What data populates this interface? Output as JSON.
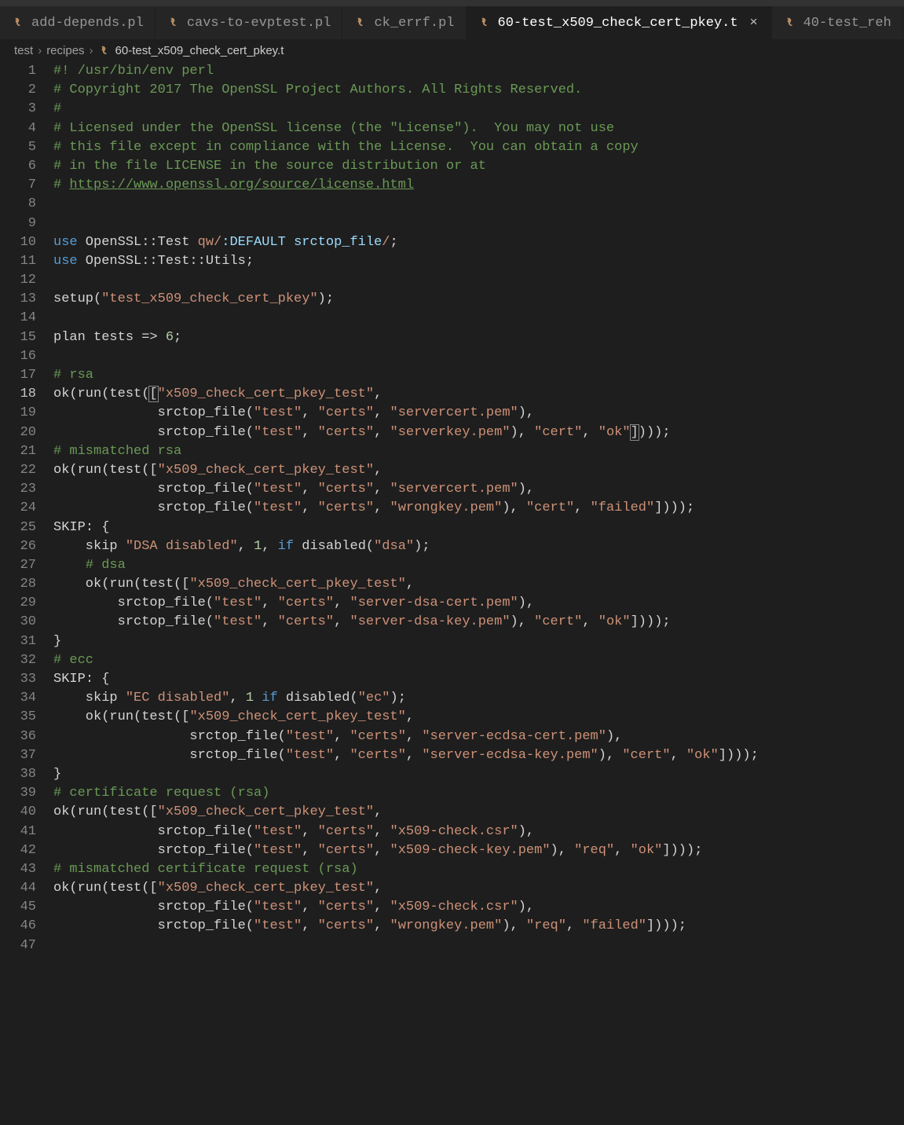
{
  "tabs": [
    {
      "label": "add-depends.pl",
      "active": false
    },
    {
      "label": "cavs-to-evptest.pl",
      "active": false
    },
    {
      "label": "ck_errf.pl",
      "active": false
    },
    {
      "label": "60-test_x509_check_cert_pkey.t",
      "active": true
    },
    {
      "label": "40-test_reh",
      "active": false
    }
  ],
  "breadcrumb": {
    "parts": [
      "test",
      "recipes"
    ],
    "file": "60-test_x509_check_cert_pkey.t"
  },
  "editor": {
    "current_line": 18,
    "lines": [
      {
        "n": 1,
        "tokens": [
          {
            "t": "#! /usr/bin/env perl",
            "c": "comment"
          }
        ]
      },
      {
        "n": 2,
        "tokens": [
          {
            "t": "# Copyright 2017 The OpenSSL Project Authors. All Rights Reserved.",
            "c": "comment"
          }
        ]
      },
      {
        "n": 3,
        "tokens": [
          {
            "t": "#",
            "c": "comment"
          }
        ]
      },
      {
        "n": 4,
        "tokens": [
          {
            "t": "# Licensed under the OpenSSL license (the \"License\").  You may not use",
            "c": "comment"
          }
        ]
      },
      {
        "n": 5,
        "tokens": [
          {
            "t": "# this file except in compliance with the License.  You can obtain a copy",
            "c": "comment"
          }
        ]
      },
      {
        "n": 6,
        "tokens": [
          {
            "t": "# in the file LICENSE in the source distribution or at",
            "c": "comment"
          }
        ]
      },
      {
        "n": 7,
        "tokens": [
          {
            "t": "# ",
            "c": "comment"
          },
          {
            "t": "https://www.openssl.org/source/license.html",
            "c": "link"
          }
        ]
      },
      {
        "n": 8,
        "tokens": []
      },
      {
        "n": 9,
        "tokens": []
      },
      {
        "n": 10,
        "tokens": [
          {
            "t": "use",
            "c": "key"
          },
          {
            "t": " OpenSSL::Test ",
            "c": "plain"
          },
          {
            "t": "qw/",
            "c": "str"
          },
          {
            "t": ":DEFAULT srctop_file",
            "c": "word"
          },
          {
            "t": "/",
            "c": "str"
          },
          {
            "t": ";",
            "c": "plain"
          }
        ]
      },
      {
        "n": 11,
        "tokens": [
          {
            "t": "use",
            "c": "key"
          },
          {
            "t": " OpenSSL::Test::Utils;",
            "c": "plain"
          }
        ]
      },
      {
        "n": 12,
        "tokens": []
      },
      {
        "n": 13,
        "tokens": [
          {
            "t": "setup(",
            "c": "plain"
          },
          {
            "t": "\"test_x509_check_cert_pkey\"",
            "c": "str"
          },
          {
            "t": ");",
            "c": "plain"
          }
        ]
      },
      {
        "n": 14,
        "tokens": []
      },
      {
        "n": 15,
        "tokens": [
          {
            "t": "plan ",
            "c": "plain"
          },
          {
            "t": "tests",
            "c": "plain"
          },
          {
            "t": " => ",
            "c": "plain"
          },
          {
            "t": "6",
            "c": "num"
          },
          {
            "t": ";",
            "c": "plain"
          }
        ]
      },
      {
        "n": 16,
        "tokens": []
      },
      {
        "n": 17,
        "tokens": [
          {
            "t": "# rsa",
            "c": "comment"
          }
        ]
      },
      {
        "n": 18,
        "tokens": [
          {
            "t": "ok(run(test(",
            "c": "plain"
          },
          {
            "t": "[",
            "c": "plain",
            "hl": true
          },
          {
            "t": "\"x509_check_cert_pkey_test\"",
            "c": "str"
          },
          {
            "t": ",",
            "c": "plain"
          }
        ]
      },
      {
        "n": 19,
        "tokens": [
          {
            "t": "             srctop_file(",
            "c": "plain"
          },
          {
            "t": "\"test\"",
            "c": "str"
          },
          {
            "t": ", ",
            "c": "plain"
          },
          {
            "t": "\"certs\"",
            "c": "str"
          },
          {
            "t": ", ",
            "c": "plain"
          },
          {
            "t": "\"servercert.pem\"",
            "c": "str"
          },
          {
            "t": "),",
            "c": "plain"
          }
        ]
      },
      {
        "n": 20,
        "tokens": [
          {
            "t": "             srctop_file(",
            "c": "plain"
          },
          {
            "t": "\"test\"",
            "c": "str"
          },
          {
            "t": ", ",
            "c": "plain"
          },
          {
            "t": "\"certs\"",
            "c": "str"
          },
          {
            "t": ", ",
            "c": "plain"
          },
          {
            "t": "\"serverkey.pem\"",
            "c": "str"
          },
          {
            "t": "), ",
            "c": "plain"
          },
          {
            "t": "\"cert\"",
            "c": "str"
          },
          {
            "t": ", ",
            "c": "plain"
          },
          {
            "t": "\"ok\"",
            "c": "str"
          },
          {
            "t": "]",
            "c": "plain",
            "hl": true
          },
          {
            "t": ")));",
            "c": "plain"
          }
        ]
      },
      {
        "n": 21,
        "tokens": [
          {
            "t": "# mismatched rsa",
            "c": "comment"
          }
        ]
      },
      {
        "n": 22,
        "tokens": [
          {
            "t": "ok(run(test([",
            "c": "plain"
          },
          {
            "t": "\"x509_check_cert_pkey_test\"",
            "c": "str"
          },
          {
            "t": ",",
            "c": "plain"
          }
        ]
      },
      {
        "n": 23,
        "tokens": [
          {
            "t": "             srctop_file(",
            "c": "plain"
          },
          {
            "t": "\"test\"",
            "c": "str"
          },
          {
            "t": ", ",
            "c": "plain"
          },
          {
            "t": "\"certs\"",
            "c": "str"
          },
          {
            "t": ", ",
            "c": "plain"
          },
          {
            "t": "\"servercert.pem\"",
            "c": "str"
          },
          {
            "t": "),",
            "c": "plain"
          }
        ]
      },
      {
        "n": 24,
        "tokens": [
          {
            "t": "             srctop_file(",
            "c": "plain"
          },
          {
            "t": "\"test\"",
            "c": "str"
          },
          {
            "t": ", ",
            "c": "plain"
          },
          {
            "t": "\"certs\"",
            "c": "str"
          },
          {
            "t": ", ",
            "c": "plain"
          },
          {
            "t": "\"wrongkey.pem\"",
            "c": "str"
          },
          {
            "t": "), ",
            "c": "plain"
          },
          {
            "t": "\"cert\"",
            "c": "str"
          },
          {
            "t": ", ",
            "c": "plain"
          },
          {
            "t": "\"failed\"",
            "c": "str"
          },
          {
            "t": "])));",
            "c": "plain"
          }
        ]
      },
      {
        "n": 25,
        "tokens": [
          {
            "t": "SKIP",
            "c": "plain"
          },
          {
            "t": ": {",
            "c": "plain"
          }
        ]
      },
      {
        "n": 26,
        "tokens": [
          {
            "t": "    skip ",
            "c": "plain"
          },
          {
            "t": "\"DSA disabled\"",
            "c": "str"
          },
          {
            "t": ", ",
            "c": "plain"
          },
          {
            "t": "1",
            "c": "num"
          },
          {
            "t": ", ",
            "c": "plain"
          },
          {
            "t": "if",
            "c": "key"
          },
          {
            "t": " disabled(",
            "c": "plain"
          },
          {
            "t": "\"dsa\"",
            "c": "str"
          },
          {
            "t": ");",
            "c": "plain"
          }
        ]
      },
      {
        "n": 27,
        "tokens": [
          {
            "t": "    ",
            "c": "plain"
          },
          {
            "t": "# dsa",
            "c": "comment"
          }
        ]
      },
      {
        "n": 28,
        "tokens": [
          {
            "t": "    ok(run(test([",
            "c": "plain"
          },
          {
            "t": "\"x509_check_cert_pkey_test\"",
            "c": "str"
          },
          {
            "t": ",",
            "c": "plain"
          }
        ]
      },
      {
        "n": 29,
        "tokens": [
          {
            "t": "        srctop_file(",
            "c": "plain"
          },
          {
            "t": "\"test\"",
            "c": "str"
          },
          {
            "t": ", ",
            "c": "plain"
          },
          {
            "t": "\"certs\"",
            "c": "str"
          },
          {
            "t": ", ",
            "c": "plain"
          },
          {
            "t": "\"server-dsa-cert.pem\"",
            "c": "str"
          },
          {
            "t": "),",
            "c": "plain"
          }
        ]
      },
      {
        "n": 30,
        "tokens": [
          {
            "t": "        srctop_file(",
            "c": "plain"
          },
          {
            "t": "\"test\"",
            "c": "str"
          },
          {
            "t": ", ",
            "c": "plain"
          },
          {
            "t": "\"certs\"",
            "c": "str"
          },
          {
            "t": ", ",
            "c": "plain"
          },
          {
            "t": "\"server-dsa-key.pem\"",
            "c": "str"
          },
          {
            "t": "), ",
            "c": "plain"
          },
          {
            "t": "\"cert\"",
            "c": "str"
          },
          {
            "t": ", ",
            "c": "plain"
          },
          {
            "t": "\"ok\"",
            "c": "str"
          },
          {
            "t": "])));",
            "c": "plain"
          }
        ]
      },
      {
        "n": 31,
        "tokens": [
          {
            "t": "}",
            "c": "plain"
          }
        ]
      },
      {
        "n": 32,
        "tokens": [
          {
            "t": "# ecc",
            "c": "comment"
          }
        ]
      },
      {
        "n": 33,
        "tokens": [
          {
            "t": "SKIP",
            "c": "plain"
          },
          {
            "t": ": {",
            "c": "plain"
          }
        ]
      },
      {
        "n": 34,
        "tokens": [
          {
            "t": "    skip ",
            "c": "plain"
          },
          {
            "t": "\"EC disabled\"",
            "c": "str"
          },
          {
            "t": ", ",
            "c": "plain"
          },
          {
            "t": "1",
            "c": "num"
          },
          {
            "t": " ",
            "c": "plain"
          },
          {
            "t": "if",
            "c": "key"
          },
          {
            "t": " disabled(",
            "c": "plain"
          },
          {
            "t": "\"ec\"",
            "c": "str"
          },
          {
            "t": ");",
            "c": "plain"
          }
        ]
      },
      {
        "n": 35,
        "tokens": [
          {
            "t": "    ok(run(test([",
            "c": "plain"
          },
          {
            "t": "\"x509_check_cert_pkey_test\"",
            "c": "str"
          },
          {
            "t": ",",
            "c": "plain"
          }
        ]
      },
      {
        "n": 36,
        "tokens": [
          {
            "t": "                 srctop_file(",
            "c": "plain"
          },
          {
            "t": "\"test\"",
            "c": "str"
          },
          {
            "t": ", ",
            "c": "plain"
          },
          {
            "t": "\"certs\"",
            "c": "str"
          },
          {
            "t": ", ",
            "c": "plain"
          },
          {
            "t": "\"server-ecdsa-cert.pem\"",
            "c": "str"
          },
          {
            "t": "),",
            "c": "plain"
          }
        ]
      },
      {
        "n": 37,
        "tokens": [
          {
            "t": "                 srctop_file(",
            "c": "plain"
          },
          {
            "t": "\"test\"",
            "c": "str"
          },
          {
            "t": ", ",
            "c": "plain"
          },
          {
            "t": "\"certs\"",
            "c": "str"
          },
          {
            "t": ", ",
            "c": "plain"
          },
          {
            "t": "\"server-ecdsa-key.pem\"",
            "c": "str"
          },
          {
            "t": "), ",
            "c": "plain"
          },
          {
            "t": "\"cert\"",
            "c": "str"
          },
          {
            "t": ", ",
            "c": "plain"
          },
          {
            "t": "\"ok\"",
            "c": "str"
          },
          {
            "t": "])));",
            "c": "plain"
          }
        ]
      },
      {
        "n": 38,
        "tokens": [
          {
            "t": "}",
            "c": "plain"
          }
        ]
      },
      {
        "n": 39,
        "tokens": [
          {
            "t": "# certificate request (rsa)",
            "c": "comment"
          }
        ]
      },
      {
        "n": 40,
        "tokens": [
          {
            "t": "ok(run(test([",
            "c": "plain"
          },
          {
            "t": "\"x509_check_cert_pkey_test\"",
            "c": "str"
          },
          {
            "t": ",",
            "c": "plain"
          }
        ]
      },
      {
        "n": 41,
        "tokens": [
          {
            "t": "             srctop_file(",
            "c": "plain"
          },
          {
            "t": "\"test\"",
            "c": "str"
          },
          {
            "t": ", ",
            "c": "plain"
          },
          {
            "t": "\"certs\"",
            "c": "str"
          },
          {
            "t": ", ",
            "c": "plain"
          },
          {
            "t": "\"x509-check.csr\"",
            "c": "str"
          },
          {
            "t": "),",
            "c": "plain"
          }
        ]
      },
      {
        "n": 42,
        "tokens": [
          {
            "t": "             srctop_file(",
            "c": "plain"
          },
          {
            "t": "\"test\"",
            "c": "str"
          },
          {
            "t": ", ",
            "c": "plain"
          },
          {
            "t": "\"certs\"",
            "c": "str"
          },
          {
            "t": ", ",
            "c": "plain"
          },
          {
            "t": "\"x509-check-key.pem\"",
            "c": "str"
          },
          {
            "t": "), ",
            "c": "plain"
          },
          {
            "t": "\"req\"",
            "c": "str"
          },
          {
            "t": ", ",
            "c": "plain"
          },
          {
            "t": "\"ok\"",
            "c": "str"
          },
          {
            "t": "])));",
            "c": "plain"
          }
        ]
      },
      {
        "n": 43,
        "tokens": [
          {
            "t": "# mismatched certificate request (rsa)",
            "c": "comment"
          }
        ]
      },
      {
        "n": 44,
        "tokens": [
          {
            "t": "ok(run(test([",
            "c": "plain"
          },
          {
            "t": "\"x509_check_cert_pkey_test\"",
            "c": "str"
          },
          {
            "t": ",",
            "c": "plain"
          }
        ]
      },
      {
        "n": 45,
        "tokens": [
          {
            "t": "             srctop_file(",
            "c": "plain"
          },
          {
            "t": "\"test\"",
            "c": "str"
          },
          {
            "t": ", ",
            "c": "plain"
          },
          {
            "t": "\"certs\"",
            "c": "str"
          },
          {
            "t": ", ",
            "c": "plain"
          },
          {
            "t": "\"x509-check.csr\"",
            "c": "str"
          },
          {
            "t": "),",
            "c": "plain"
          }
        ]
      },
      {
        "n": 46,
        "tokens": [
          {
            "t": "             srctop_file(",
            "c": "plain"
          },
          {
            "t": "\"test\"",
            "c": "str"
          },
          {
            "t": ", ",
            "c": "plain"
          },
          {
            "t": "\"certs\"",
            "c": "str"
          },
          {
            "t": ", ",
            "c": "plain"
          },
          {
            "t": "\"wrongkey.pem\"",
            "c": "str"
          },
          {
            "t": "), ",
            "c": "plain"
          },
          {
            "t": "\"req\"",
            "c": "str"
          },
          {
            "t": ", ",
            "c": "plain"
          },
          {
            "t": "\"failed\"",
            "c": "str"
          },
          {
            "t": "])));",
            "c": "plain"
          }
        ]
      },
      {
        "n": 47,
        "tokens": []
      }
    ]
  }
}
